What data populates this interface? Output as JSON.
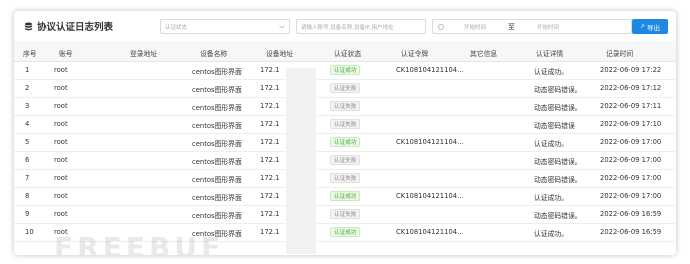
{
  "title": "协议认证日志列表",
  "filters": {
    "status_placeholder": "认证状态",
    "search_placeholder": "请输入账号,设备名称,设备IP,用户地址",
    "date_start_placeholder": "开始时间",
    "date_separator": "至",
    "date_end_placeholder": "开始时间"
  },
  "export_label": "导出",
  "columns": [
    "序号",
    "账号",
    "登录地址",
    "设备名称",
    "设备地址",
    "认证状态",
    "认证令牌",
    "其它信息",
    "认证详情",
    "记录时间"
  ],
  "rows": [
    {
      "no": "1",
      "account": "root",
      "login_addr": "",
      "device_name": "centos图形界面",
      "device_addr": "172.1",
      "status": "认证成功",
      "status_ok": true,
      "token": "CK108104121104...",
      "other": "",
      "detail": "认证成功。",
      "time": "2022-06-09 17:22"
    },
    {
      "no": "2",
      "account": "root",
      "login_addr": "",
      "device_name": "centos图形界面",
      "device_addr": "172.1",
      "status": "认证失败",
      "status_ok": false,
      "token": "",
      "other": "",
      "detail": "动态密码错误。",
      "time": "2022-06-09 17:12"
    },
    {
      "no": "3",
      "account": "root",
      "login_addr": "",
      "device_name": "centos图形界面",
      "device_addr": "172.1",
      "status": "认证失败",
      "status_ok": false,
      "token": "",
      "other": "",
      "detail": "动态密码错误。",
      "time": "2022-06-09 17:11"
    },
    {
      "no": "4",
      "account": "root",
      "login_addr": "",
      "device_name": "centos图形界面",
      "device_addr": "172.1",
      "status": "认证失败",
      "status_ok": false,
      "token": "",
      "other": "",
      "detail": "动态密码错误",
      "time": "2022-06-09 17:10"
    },
    {
      "no": "5",
      "account": "root",
      "login_addr": "",
      "device_name": "centos图形界面",
      "device_addr": "172.1",
      "status": "认证成功",
      "status_ok": true,
      "token": "CK108104121104...",
      "other": "",
      "detail": "认证成功。",
      "time": "2022-06-09 17:00"
    },
    {
      "no": "6",
      "account": "root",
      "login_addr": "",
      "device_name": "centos图形界面",
      "device_addr": "172.1",
      "status": "认证失败",
      "status_ok": false,
      "token": "",
      "other": "",
      "detail": "动态密码错误。",
      "time": "2022-06-09 17:00"
    },
    {
      "no": "7",
      "account": "root",
      "login_addr": "",
      "device_name": "centos图形界面",
      "device_addr": "172.1",
      "status": "认证失败",
      "status_ok": false,
      "token": "",
      "other": "",
      "detail": "动态密码错误。",
      "time": "2022-06-09 17:00"
    },
    {
      "no": "8",
      "account": "root",
      "login_addr": "",
      "device_name": "centos图形界面",
      "device_addr": "172.1",
      "status": "认证成功",
      "status_ok": true,
      "token": "CK108104121104...",
      "other": "",
      "detail": "认证成功。",
      "time": "2022-06-09 17:00"
    },
    {
      "no": "9",
      "account": "root",
      "login_addr": "",
      "device_name": "centos图形界面",
      "device_addr": "172.1",
      "status": "认证失败",
      "status_ok": false,
      "token": "",
      "other": "",
      "detail": "动态密码错误。",
      "time": "2022-06-09 16:59"
    },
    {
      "no": "10",
      "account": "root",
      "login_addr": "",
      "device_name": "centos图形界面",
      "device_addr": "172.1",
      "status": "认证成功",
      "status_ok": true,
      "token": "CK108104121104...",
      "other": "",
      "detail": "认证成功。",
      "time": "2022-06-09 16:59"
    }
  ],
  "watermark": "FREEBUF",
  "colors": {
    "accent": "#1e88e5",
    "success": "#4aa83a"
  },
  "icons": {
    "title": "database-icon",
    "status_select": "chevron-down-icon",
    "date": "clock-icon",
    "export": "export-arrow-icon"
  }
}
